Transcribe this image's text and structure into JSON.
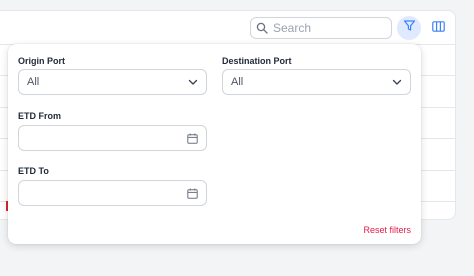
{
  "toolbar": {
    "search_placeholder": "Search",
    "search_icon": "search-icon",
    "filter_icon": "filter-icon",
    "columns_icon": "columns-icon"
  },
  "filters": {
    "origin_port": {
      "label": "Origin Port",
      "value": "All",
      "icon": "chevron-down-icon"
    },
    "destination_port": {
      "label": "Destination Port",
      "value": "All",
      "icon": "chevron-down-icon"
    },
    "etd_from": {
      "label": "ETD From",
      "value": "",
      "icon": "calendar-icon"
    },
    "etd_to": {
      "label": "ETD To",
      "value": "",
      "icon": "calendar-icon"
    },
    "reset_label": "Reset filters"
  },
  "colors": {
    "accent": "#3b82f6",
    "reset": "#e11d48",
    "filter_active_bg": "#e0eaff"
  }
}
